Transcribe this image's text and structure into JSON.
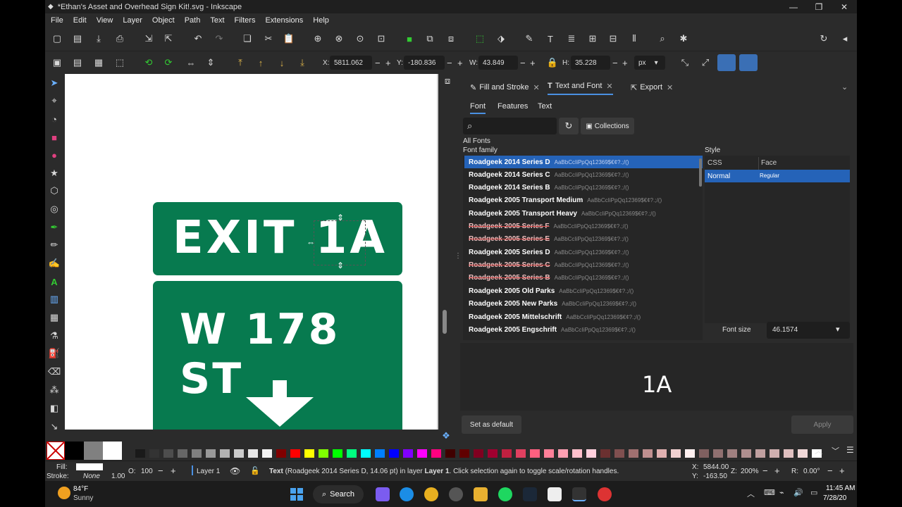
{
  "window": {
    "title": "*Ethan's Asset and Overhead Sign Kit!.svg - Inkscape"
  },
  "menu": [
    "File",
    "Edit",
    "View",
    "Layer",
    "Object",
    "Path",
    "Text",
    "Filters",
    "Extensions",
    "Help"
  ],
  "ctrl": {
    "x_label": "X:",
    "x": "5811.062",
    "y_label": "Y:",
    "y": "-180.836",
    "w_label": "W:",
    "w": "43.849",
    "h_label": "H:",
    "h": "35.228",
    "unit": "px"
  },
  "sign": {
    "top": "EXIT  1A",
    "bottom": "W 178 ST"
  },
  "panel": {
    "tabs": [
      "Fill and Stroke",
      "Text and Font",
      "Export"
    ],
    "subtabs": [
      "Font",
      "Features",
      "Text"
    ],
    "collections": "Collections",
    "all_fonts": "All Fonts",
    "font_family": "Font family",
    "style": "Style",
    "css_col": "CSS",
    "face_col": "Face",
    "style_css": "Normal",
    "style_face": "Regular",
    "font_size_label": "Font size",
    "font_size": "46.1574",
    "preview": "1A",
    "set_default": "Set as default",
    "apply": "Apply",
    "fonts": [
      {
        "name": "Roadgeek 2014 Series D",
        "preview": "AaBbCcIiPpQq12369$€¢?.;/()"
      },
      {
        "name": "Roadgeek 2014 Series C",
        "preview": "AaBbCcIiPpQq12369$€¢?.;/()"
      },
      {
        "name": "Roadgeek 2014 Series B",
        "preview": "AaBbCcIiPpQq12369$€¢?.;/()"
      },
      {
        "name": "Roadgeek 2005 Transport Medium",
        "preview": "AaBbCcIiPpQq12369$€¢?.;/()"
      },
      {
        "name": "Roadgeek 2005 Transport Heavy",
        "preview": "AaBbCcIiPpQq12369$€¢?.;/()"
      },
      {
        "name": "Roadgeek 2005 Series F",
        "preview": "AaBbCcIiPpQq12369$€¢?.;/()"
      },
      {
        "name": "Roadgeek 2005 Series E",
        "preview": "AaBbCcIiPpQq12369$€¢?.;/()"
      },
      {
        "name": "Roadgeek 2005 Series D",
        "preview": "AaBbCcIiPpQq12369$€¢?.;/()"
      },
      {
        "name": "Roadgeek 2005 Series C",
        "preview": "AaBbCcIiPpQq12369$€¢?.;/()"
      },
      {
        "name": "Roadgeek 2005 Series B",
        "preview": "AaBbCcIiPpQq12369$€¢?.;/()"
      },
      {
        "name": "Roadgeek 2005 Old Parks",
        "preview": "AaBbCcIiPpQq12369$€¢?.;/()"
      },
      {
        "name": "Roadgeek 2005 New Parks",
        "preview": "AaBbCcIiPpQq12369$€¢?.;/()"
      },
      {
        "name": "Roadgeek 2005 Mittelschrift",
        "preview": "AaBbCcIiPpQq12369$€¢?.;/()"
      },
      {
        "name": "Roadgeek 2005 Engschrift",
        "preview": "AaBbCcIiPpQq12369$€¢?.;/()"
      }
    ]
  },
  "status": {
    "fill_label": "Fill:",
    "stroke_label": "Stroke:",
    "stroke_value": "None",
    "stroke_width": "1.00",
    "opacity_label": "O:",
    "opacity": "100",
    "layer": "Layer 1",
    "message_bold": "Text",
    "message": " (Roadgeek 2014 Series D, 14.06 pt) in layer ",
    "message_layer": "Layer 1",
    "message_tail": ". Click selection again to toggle scale/rotation handles.",
    "cx_label": "X:",
    "cx": "5844.00",
    "cy_label": "Y:",
    "cy": "-163.50",
    "zoom_label": "Z:",
    "zoom": "200%",
    "rot_label": "R:",
    "rotation": "0.00°"
  },
  "taskbar": {
    "temp": "84°F",
    "weather": "Sunny",
    "search": "Search",
    "time": "11:45 AM",
    "date": "7/28/20"
  },
  "colors": {
    "sign_green": "#077a4f",
    "selected": "#2563b8",
    "accent": "#4a90e2"
  }
}
